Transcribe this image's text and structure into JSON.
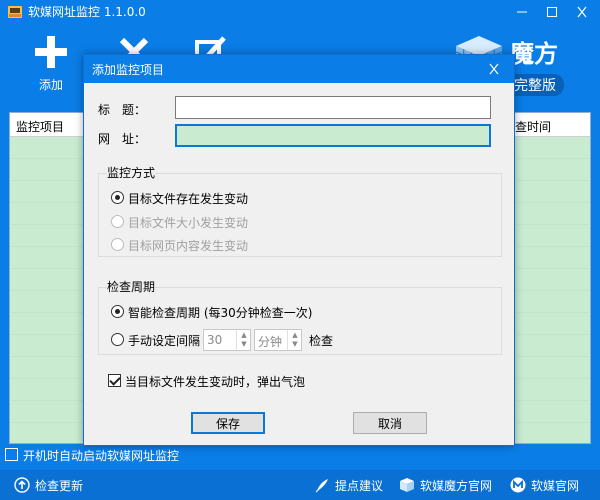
{
  "app": {
    "title": "软媒网址监控 1.1.0.0",
    "toolbar": {
      "add_label": "添加",
      "brand_name": "魔方",
      "brand_badge": "完整版"
    },
    "list": {
      "columns": [
        "监控项目",
        "查时间"
      ]
    },
    "autostart_label": "开机时自动启动软媒网址监控",
    "autostart_checked": false,
    "statusbar": {
      "check_update": "检查更新",
      "suggest": "提点建议",
      "mofang_site": "软媒魔方官网",
      "ruanmei_site": "软媒官网"
    }
  },
  "dialog": {
    "title": "添加监控项目",
    "title_label": "标　题：",
    "title_value": "",
    "url_label": "网　址：",
    "url_value": "",
    "monitor_group": {
      "title": "监控方式",
      "options": [
        {
          "label": "目标文件存在发生变动",
          "checked": true,
          "enabled": true
        },
        {
          "label": "目标文件大小发生变动",
          "checked": false,
          "enabled": false
        },
        {
          "label": "目标网页内容发生变动",
          "checked": false,
          "enabled": false
        }
      ]
    },
    "period_group": {
      "title": "检查周期",
      "smart_label": "智能检查周期 (每30分钟检查一次)",
      "manual_label": "手动设定间隔",
      "interval_value": "30",
      "unit_value": "分钟",
      "suffix": "检查"
    },
    "notify_label": "当目标文件发生变动时，弹出气泡",
    "notify_checked": true,
    "save_label": "保存",
    "cancel_label": "取消"
  },
  "colors": {
    "accent": "#0a7de6",
    "list_bg": "#c9ecd0",
    "statusbar": "#0a70d4"
  }
}
